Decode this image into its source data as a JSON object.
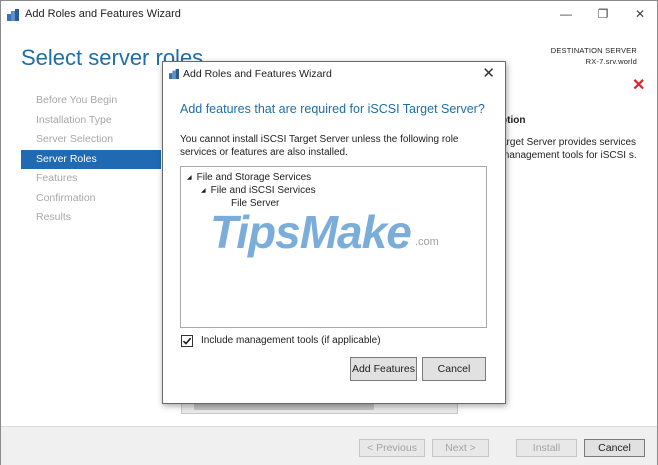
{
  "window": {
    "title": "Add Roles and Features Wizard",
    "minimize_glyph": "—",
    "restore_glyph": "❐",
    "close_glyph": "✕"
  },
  "page": {
    "heading": "Select server roles",
    "destination_label": "DESTINATION SERVER",
    "destination_server": "RX-7.srv.world"
  },
  "nav": {
    "items": [
      {
        "label": "Before You Begin",
        "active": false
      },
      {
        "label": "Installation Type",
        "active": false
      },
      {
        "label": "Server Selection",
        "active": false
      },
      {
        "label": "Server Roles",
        "active": true
      },
      {
        "label": "Features",
        "active": false
      },
      {
        "label": "Confirmation",
        "active": false
      },
      {
        "label": "Results",
        "active": false
      }
    ]
  },
  "description": {
    "title_fragment": "ption",
    "text_fragment": "arget Server provides services management tools for iSCSI s."
  },
  "footer": {
    "previous": "< Previous",
    "next": "Next >",
    "install": "Install",
    "cancel": "Cancel"
  },
  "dialog": {
    "title": "Add Roles and Features Wizard",
    "heading": "Add features that are required for iSCSI Target Server?",
    "message": "You cannot install iSCSI Target Server unless the following role services or features are also installed.",
    "tree": [
      {
        "label": "File and Storage Services",
        "level": 0,
        "expanded": true
      },
      {
        "label": "File and iSCSI Services",
        "level": 1,
        "expanded": true
      },
      {
        "label": "File Server",
        "level": 2,
        "expanded": false
      }
    ],
    "include_tools_label": "Include management tools (if applicable)",
    "include_tools_checked": true,
    "add_features": "Add Features",
    "cancel": "Cancel"
  },
  "watermark": {
    "text": "TipsMake",
    "suffix": ".com"
  },
  "icons": {
    "app": "server-manager-icon",
    "close": "close-icon",
    "error": "error-x-icon",
    "checkbox": "checkmark-icon"
  },
  "colors": {
    "accent": "#1d6fa5",
    "nav_active": "#1f6ab2",
    "error": "#d9232d"
  }
}
